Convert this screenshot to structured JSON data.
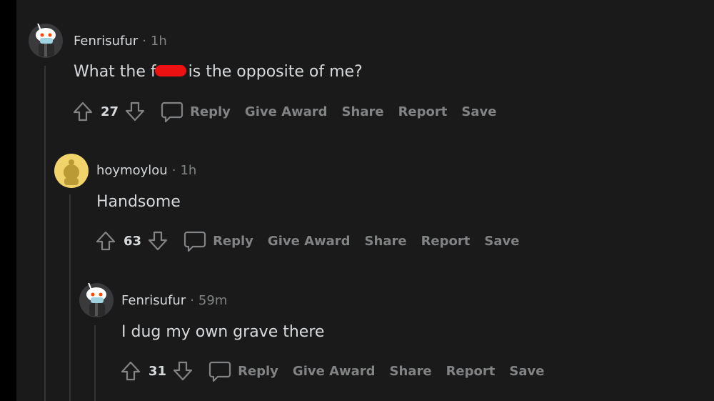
{
  "theme": {
    "background": "#1a1a1b",
    "text": "#d7dadc",
    "muted": "#818384",
    "redaction": "#ee1111"
  },
  "comments": [
    {
      "author": "Fenrisufur",
      "separator": "·",
      "time": "1h",
      "text_before": "What the f",
      "text_after": "is the opposite of me?",
      "score": "27",
      "avatar_icon": "snoo-avatar-icon",
      "actions": {
        "reply": "Reply",
        "award": "Give Award",
        "share": "Share",
        "report": "Report",
        "save": "Save"
      }
    },
    {
      "author": "hoymoylou",
      "separator": "·",
      "time": "1h",
      "text": "Handsome",
      "score": "63",
      "avatar_icon": "snoo-avatar-icon",
      "actions": {
        "reply": "Reply",
        "award": "Give Award",
        "share": "Share",
        "report": "Report",
        "save": "Save"
      }
    },
    {
      "author": "Fenrisufur",
      "separator": "·",
      "time": "59m",
      "text": "I dug my own grave there",
      "score": "31",
      "avatar_icon": "snoo-avatar-icon",
      "actions": {
        "reply": "Reply",
        "award": "Give Award",
        "share": "Share",
        "report": "Report",
        "save": "Save"
      }
    }
  ]
}
